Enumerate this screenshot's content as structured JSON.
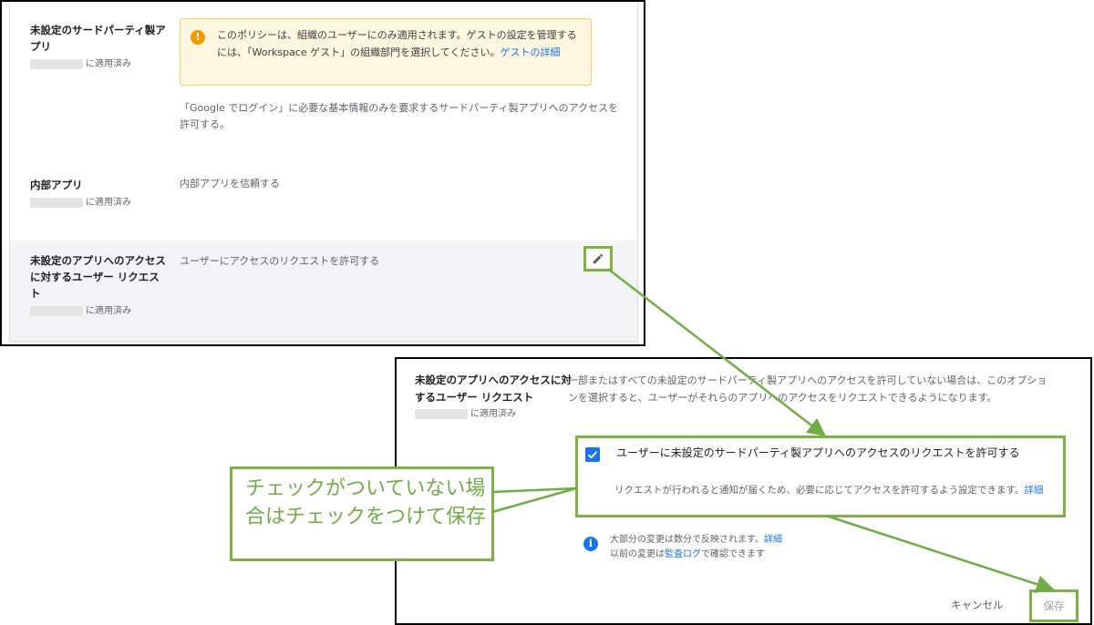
{
  "top_panel": {
    "row1": {
      "title": "未設定のサードパーティ製アプリ",
      "applied_suffix": "に適用済み",
      "warning_text": "このポリシーは、組織のユーザーにのみ適用されます。ゲストの設定を管理するには、「Workspace ゲスト」の組織部門を選択してください。",
      "warning_link": "ゲストの詳細",
      "description": "「Google でログイン」に必要な基本情報のみを要求するサードパーティ製アプリへのアクセスを許可する。"
    },
    "row2": {
      "title": "内部アプリ",
      "applied_suffix": "に適用済み",
      "description": "内部アプリを信頼する"
    },
    "row3": {
      "title": "未設定のアプリへのアクセスに対するユーザー リクエスト",
      "applied_suffix": "に適用済み",
      "description": "ユーザーにアクセスのリクエストを許可する",
      "edit_icon": "pencil-icon"
    }
  },
  "bottom_panel": {
    "title": "未設定のアプリへのアクセスに対するユーザー リクエスト",
    "applied_suffix": "に適用済み",
    "description": "一部またはすべての未設定のサードパーティ製アプリへのアクセスを許可していない場合は、このオプションを選択すると、ユーザーがそれらのアプリへのアクセスをリクエストできるようになります。",
    "checkbox": {
      "checked": true,
      "label": "ユーザーに未設定のサードパーティ製アプリへのアクセスのリクエストを許可する",
      "helper": "リクエストが行われると通知が届くため、必要に応じてアクセスを許可するよう設定できます。",
      "helper_link": "詳細"
    },
    "info": {
      "line1": "大部分の変更は数分で反映されます。",
      "line1_link": "詳細",
      "line2_prefix": "以前の変更は",
      "line2_link": "監査ログ",
      "line2_suffix": "で確認できます"
    },
    "cancel_label": "キャンセル",
    "save_label": "保存"
  },
  "annotation": {
    "text": "チェックがついていない場合はチェックをつけて保存"
  },
  "colors": {
    "annotation_green": "#70ad47",
    "highlight_border": "#7cb342",
    "link_blue": "#1a73e8",
    "warning_bg": "#fef7e0",
    "warning_icon": "#f29900",
    "checkbox_blue": "#1a73e8"
  }
}
